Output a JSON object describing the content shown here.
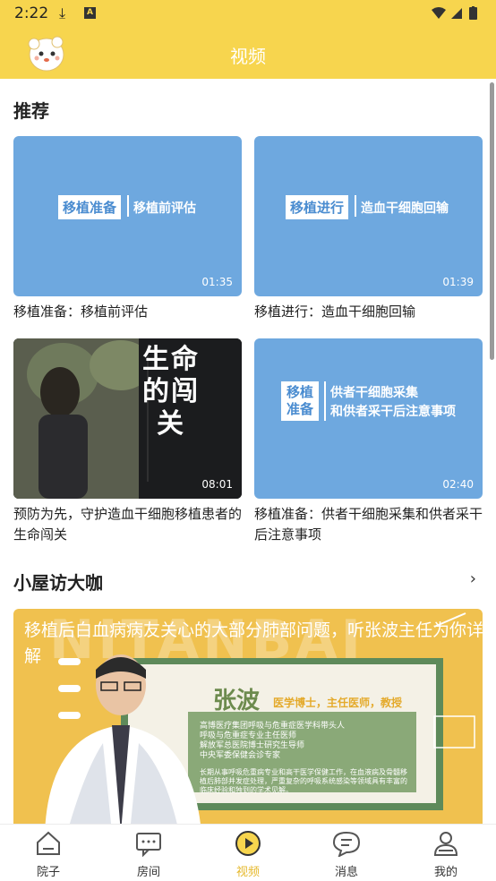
{
  "status": {
    "time": "2:22"
  },
  "header": {
    "title": "视频"
  },
  "recommend": {
    "title": "推荐",
    "cards": [
      {
        "caption": "移植准备：移植前评估",
        "duration": "01:35",
        "pill": "移植准备",
        "thumb_text": "移植前评估"
      },
      {
        "caption": "移植进行：造血干细胞回输",
        "duration": "01:39",
        "pill": "移植进行",
        "thumb_text": "造血干细胞回输"
      },
      {
        "caption": "预防为先，守护造血干细胞移植患者的生命闯关",
        "duration": "08:01",
        "thumb_text": "生命的闯关"
      },
      {
        "caption": "移植准备：供者干细胞采集和供者采干后注意事项",
        "duration": "02:40",
        "pill_line1": "移植",
        "pill_line2": "准备",
        "thumb_line1": "供者干细胞采集",
        "thumb_line2": "和供者采干后注意事项"
      }
    ]
  },
  "visit": {
    "title": "小屋访大咖",
    "banner_text": "移植后白血病病友关心的大部分肺部问题，听张波主任为你详解",
    "watermark": "NITANBAI",
    "doctor_name": "张波",
    "doctor_title": "医学博士，主任医师，教授",
    "doctor_lines": [
      "高博医疗集团呼吸与危重症医学科带头人",
      "呼吸与危重症专业主任医师",
      "解放军总医院博士研究生导师",
      "中央军委保健会诊专家"
    ],
    "doctor_bio": "长期从事呼吸危重病专业和高干医学保健工作，在血液病及骨髓移植后肺部并发症处理，严重复杂的呼吸系统感染等领域具有丰富的临床经验和独到的学术见解。"
  },
  "nav": [
    {
      "label": "院子",
      "icon": "house-icon"
    },
    {
      "label": "房间",
      "icon": "chat-box-icon"
    },
    {
      "label": "视频",
      "icon": "play-icon",
      "active": true
    },
    {
      "label": "消息",
      "icon": "message-icon"
    },
    {
      "label": "我的",
      "icon": "person-icon"
    }
  ],
  "colors": {
    "accent": "#f7d54e",
    "thumb_blue": "#6ea8df",
    "active": "#e6b92c"
  }
}
